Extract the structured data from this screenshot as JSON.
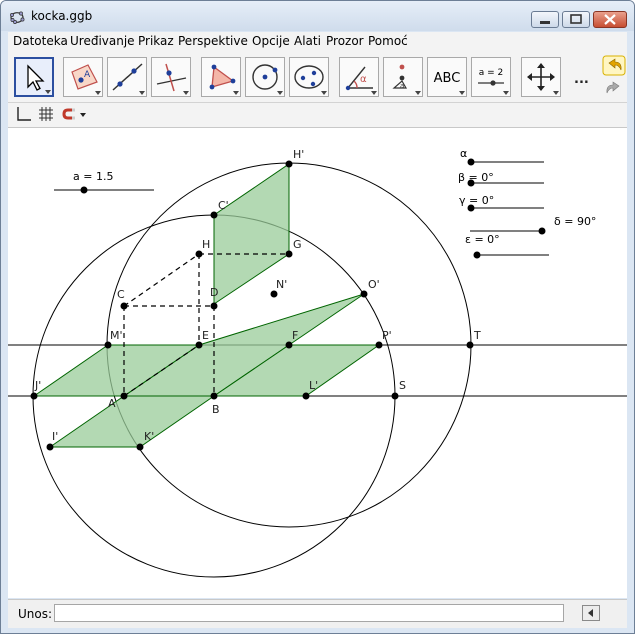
{
  "window": {
    "title": "kocka.ggb"
  },
  "menu": [
    {
      "id": "datoteka",
      "label": "Datoteka"
    },
    {
      "id": "uredivanje",
      "label": "Uređivanje"
    },
    {
      "id": "prikaz",
      "label": "Prikaz"
    },
    {
      "id": "perspektive",
      "label": "Perspektive"
    },
    {
      "id": "opcije",
      "label": "Opcije"
    },
    {
      "id": "alati",
      "label": "Alati"
    },
    {
      "id": "prozor",
      "label": "Prozor"
    },
    {
      "id": "pomoc",
      "label": "Pomoć"
    }
  ],
  "toolbar": {
    "text_tool_label": "ABC",
    "slider_tool_label": "a = 2",
    "more_label": "..."
  },
  "sliders": {
    "a": {
      "label": "a = 1.5",
      "value": 1.5
    },
    "alpha": {
      "label": "α"
    },
    "beta": {
      "label": "β = 0°"
    },
    "gamma": {
      "label": "γ = 0°"
    },
    "delta": {
      "label": "δ = 90°"
    },
    "epsilon": {
      "label": "ε = 0°"
    }
  },
  "points": {
    "H_": "H'",
    "C_": "C'",
    "H": "H",
    "G": "G",
    "C": "C",
    "D": "D",
    "N_": "N'",
    "O_": "O'",
    "M_": "M'",
    "E": "E",
    "F": "F",
    "P_": "P'",
    "T": "T",
    "J_": "J'",
    "A": "A",
    "L_": "L'",
    "S": "S",
    "B": "B",
    "I_": "I'",
    "K_": "K'"
  },
  "inputbar": {
    "label": "Unos:",
    "value": ""
  },
  "colors": {
    "fill": "#99cc99",
    "stroke": "#006400",
    "line": "#000000",
    "point": "#000000",
    "accent": "#2c4fa0"
  }
}
